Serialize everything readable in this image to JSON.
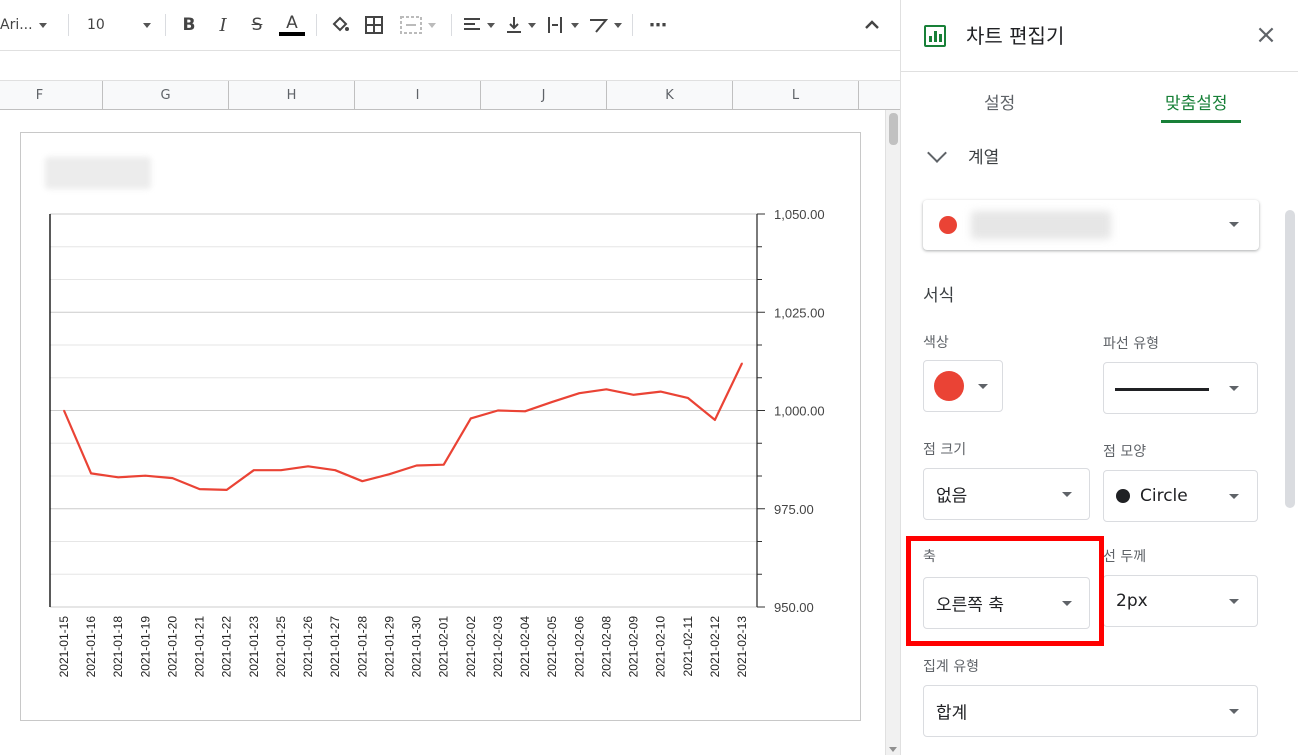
{
  "toolbar": {
    "font_name": "Ari...",
    "font_size": "10",
    "bold": "B",
    "italic": "I",
    "strike": "S",
    "text_color": "A",
    "more": "⋯"
  },
  "columns": [
    "F",
    "G",
    "H",
    "I",
    "J",
    "K",
    "L"
  ],
  "chart_data": {
    "type": "line",
    "x": [
      "2021-01-15",
      "2021-01-16",
      "2021-01-18",
      "2021-01-19",
      "2021-01-20",
      "2021-01-21",
      "2021-01-22",
      "2021-01-23",
      "2021-01-25",
      "2021-01-26",
      "2021-01-27",
      "2021-01-28",
      "2021-01-29",
      "2021-01-30",
      "2021-02-01",
      "2021-02-02",
      "2021-02-03",
      "2021-02-04",
      "2021-02-05",
      "2021-02-06",
      "2021-02-08",
      "2021-02-09",
      "2021-02-10",
      "2021-02-11",
      "2021-02-12",
      "2021-02-13"
    ],
    "series": [
      {
        "color": "#ea4335",
        "values": [
          1000.0,
          984.0,
          983.0,
          983.4,
          982.8,
          980.0,
          979.8,
          984.8,
          984.8,
          985.8,
          984.8,
          982.0,
          983.8,
          986.0,
          986.2,
          998.0,
          1000.0,
          999.8,
          1002.2,
          1004.4,
          1005.4,
          1004.0,
          1004.8,
          1003.2,
          997.6,
          1012.0
        ]
      }
    ],
    "y_axis": {
      "position": "right",
      "ylim": [
        950,
        1050
      ],
      "ticks": [
        "1,050.00",
        "1,025.00",
        "1,000.00",
        "975.00",
        "950.00"
      ]
    },
    "grid": true,
    "legend": "none"
  },
  "editor": {
    "title": "차트 편집기",
    "close": "×",
    "tabs": [
      {
        "label": "설정",
        "active": false
      },
      {
        "label": "맞춤설정",
        "active": true
      }
    ],
    "section_title": "계열",
    "format_heading": "서식",
    "color_label": "색상",
    "color_value": "#ea4335",
    "dash_label": "파선 유형",
    "point_size_label": "점 크기",
    "point_size_value": "없음",
    "point_shape_label": "점 모양",
    "point_shape_value": "Circle",
    "axis_label": "축",
    "axis_value": "오른쪽 축",
    "line_width_label": "선 두께",
    "line_width_value": "2px",
    "aggregate_label": "집계 유형",
    "aggregate_value": "합계"
  }
}
